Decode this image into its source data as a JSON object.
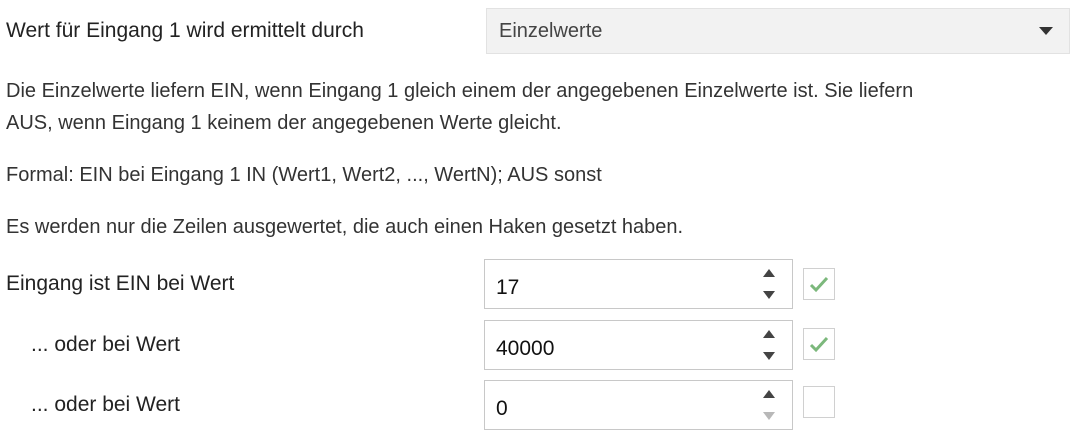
{
  "evaluation": {
    "label": "Wert für Eingang 1 wird ermittelt durch",
    "selected": "Einzelwerte"
  },
  "description": {
    "line1": "Die Einzelwerte liefern EIN, wenn Eingang 1 gleich einem der angegebenen Einzelwerte ist. Sie liefern",
    "line2": "AUS, wenn Eingang 1 keinem der angegebenen Werte gleicht.",
    "formal": "Formal: EIN bei Eingang 1 IN (Wert1, Wert2, ..., WertN); AUS sonst",
    "note": "Es werden nur die Zeilen ausgewertet, die auch einen Haken gesetzt haben."
  },
  "rows": [
    {
      "label": "Eingang ist EIN bei Wert",
      "value": "17",
      "checked": true
    },
    {
      "label": "... oder bei Wert",
      "value": "40000",
      "checked": true
    },
    {
      "label": "... oder bei Wert",
      "value": "0",
      "checked": false
    }
  ],
  "colors": {
    "check": "#7cb87c",
    "text": "#222222",
    "dropdown_bg": "#f2f2f2"
  },
  "icons": {
    "dropdown": "caret-down-icon",
    "increment": "arrow-up-icon",
    "decrement": "arrow-down-icon",
    "check": "check-icon"
  }
}
